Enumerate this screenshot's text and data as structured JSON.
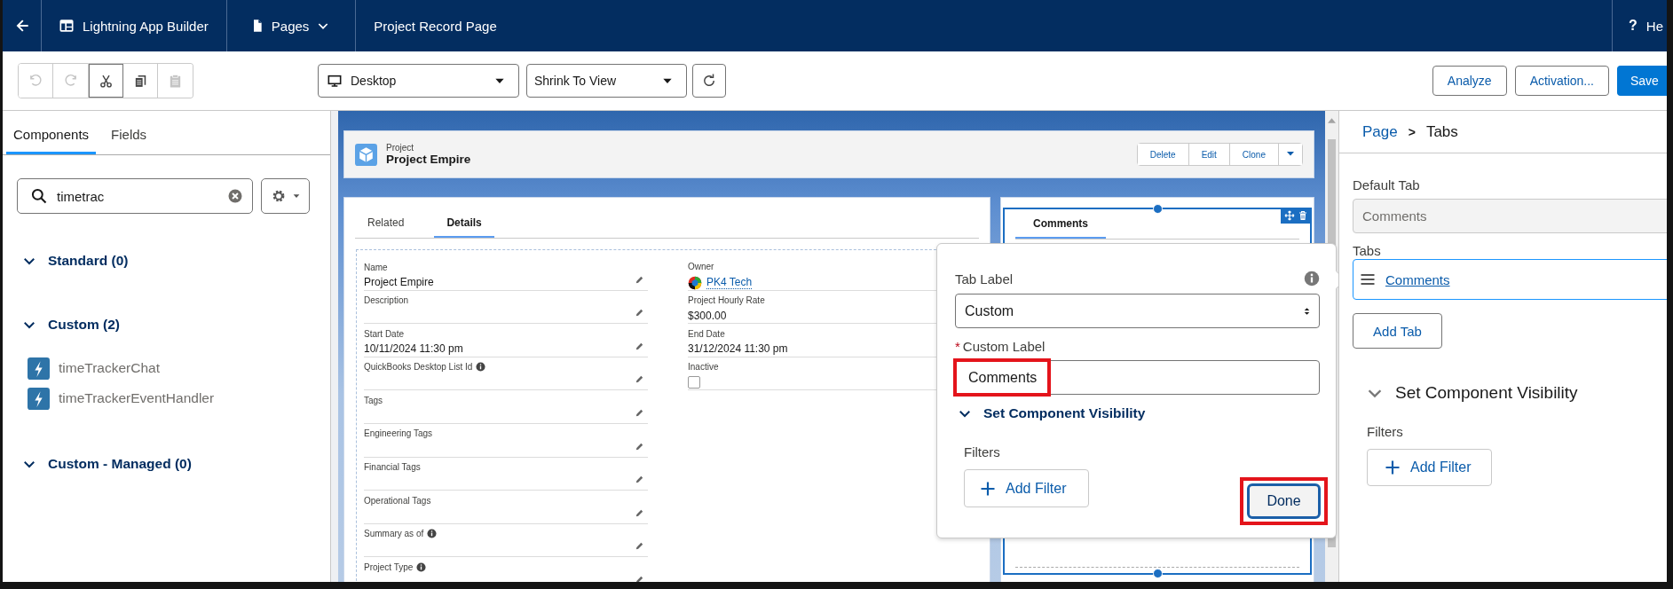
{
  "header": {
    "title": "Lightning App Builder",
    "pages_menu": "Pages",
    "page_name": "Project Record Page",
    "help_icon": "?",
    "help_label": "He"
  },
  "toolbar": {
    "edit_tools": [
      {
        "kind": "undo",
        "disabled": true
      },
      {
        "kind": "redo",
        "disabled": true
      },
      {
        "kind": "cut",
        "disabled": false
      },
      {
        "kind": "copy",
        "disabled": false
      },
      {
        "kind": "paste",
        "disabled": true
      }
    ],
    "device": "Desktop",
    "zoom": "Shrink To View",
    "buttons": [
      {
        "label": "Analyze",
        "kind": "outline"
      },
      {
        "label": "Activation...",
        "kind": "outline"
      },
      {
        "label": "Save",
        "kind": "brand"
      }
    ]
  },
  "left_panel": {
    "tabs": [
      {
        "label": "Components",
        "selected": true
      },
      {
        "label": "Fields",
        "selected": false
      }
    ],
    "search": {
      "value": "timetrac"
    },
    "sections": [
      {
        "title": "Standard (0)",
        "expanded": true
      },
      {
        "title": "Custom (2)",
        "expanded": true,
        "items": [
          "timeTrackerChat",
          "timeTrackerEventHandler"
        ]
      },
      {
        "title": "Custom - Managed (0)",
        "expanded": true
      }
    ]
  },
  "record": {
    "object": "Project",
    "name": "Project Empire",
    "actions": [
      "Delete",
      "Edit",
      "Clone"
    ],
    "tabs": [
      {
        "label": "Related",
        "selected": false
      },
      {
        "label": "Details",
        "selected": true
      }
    ],
    "left_fields": [
      {
        "label": "Name",
        "value": "Project Empire",
        "info": false
      },
      {
        "label": "Description",
        "info": false
      },
      {
        "label": "Start Date",
        "value": "10/11/2024 11:30 pm",
        "info": false
      },
      {
        "label": "QuickBooks Desktop List Id",
        "info": true
      },
      {
        "label": "Tags",
        "info": false
      },
      {
        "label": "Engineering Tags",
        "info": false
      },
      {
        "label": "Financial Tags",
        "info": false
      },
      {
        "label": "Operational Tags",
        "info": false
      },
      {
        "label": "Summary as of",
        "info": true
      },
      {
        "label": "Project Type",
        "info": true
      }
    ],
    "right_fields": [
      {
        "label": "Owner",
        "value": "PK4 Tech",
        "kind": "user"
      },
      {
        "label": "Project Hourly Rate",
        "value": "$300.00",
        "kind": "text"
      },
      {
        "label": "End Date",
        "value": "31/12/2024 11:30 pm",
        "kind": "text"
      },
      {
        "label": "Inactive",
        "kind": "checkbox",
        "checked": false
      }
    ],
    "component_tab": "Comments"
  },
  "popover": {
    "tab_label": {
      "label": "Tab Label",
      "value": "Custom"
    },
    "custom_label": {
      "label": "Custom Label",
      "required": true,
      "required_mark": "*",
      "value": "Comments",
      "highlighted": true
    },
    "visibility": {
      "title": "Set Component Visibility",
      "expanded": true
    },
    "filters_label": "Filters",
    "add_filter": "Add Filter",
    "done": {
      "label": "Done",
      "highlighted": true
    }
  },
  "properties": {
    "breadcrumb": [
      {
        "label": "Page",
        "kind": "link"
      },
      {
        "label": "Tabs",
        "kind": "current"
      }
    ],
    "separator": ">",
    "default_tab": {
      "label": "Default Tab",
      "value": "Comments",
      "disabled": true
    },
    "tabs_label": "Tabs",
    "tabs": [
      {
        "label": "Comments",
        "selected": true
      }
    ],
    "add_tab": "Add Tab",
    "visibility": {
      "title": "Set Component Visibility",
      "expanded": true
    },
    "filters_label": "Filters",
    "add_filter": "Add Filter"
  }
}
